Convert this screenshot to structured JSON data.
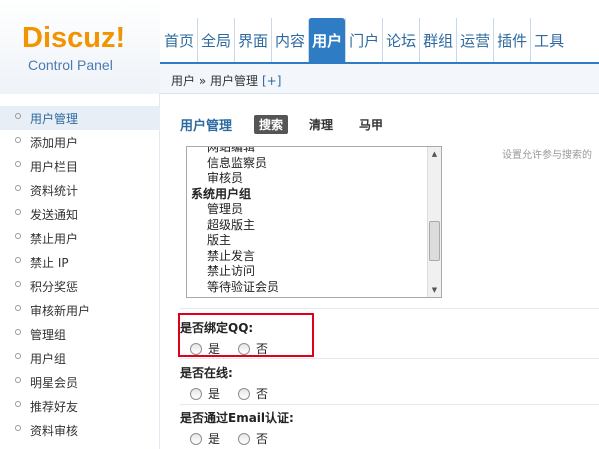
{
  "logo": {
    "title": "Discuz!",
    "subtitle": "Control Panel"
  },
  "nav": {
    "items": [
      "首页",
      "全局",
      "界面",
      "内容",
      "用户",
      "门户",
      "论坛",
      "群组",
      "运营",
      "插件",
      "工具"
    ],
    "active_index": 4
  },
  "breadcrumb": {
    "text": "用户 » 用户管理",
    "plus": "[+]"
  },
  "sidebar": {
    "items": [
      "用户管理",
      "添加用户",
      "用户栏目",
      "资料统计",
      "发送通知",
      "禁止用户",
      "禁止 IP",
      "积分奖惩",
      "审核新用户",
      "管理组",
      "用户组",
      "明星会员",
      "推荐好友",
      "资料审核"
    ],
    "active_index": 0
  },
  "subtabs": {
    "title": "用户管理",
    "items": [
      "搜索",
      "清理",
      "马甲"
    ],
    "active_index": 0
  },
  "hint": "设置允许参与搜索的",
  "listbox": {
    "options": [
      {
        "text": "网站编辑",
        "group": false
      },
      {
        "text": "信息监察员",
        "group": false
      },
      {
        "text": "审核员",
        "group": false
      },
      {
        "text": "系统用户组",
        "group": true
      },
      {
        "text": "管理员",
        "group": false
      },
      {
        "text": "超级版主",
        "group": false
      },
      {
        "text": "版主",
        "group": false
      },
      {
        "text": "禁止发言",
        "group": false
      },
      {
        "text": "禁止访问",
        "group": false
      },
      {
        "text": "等待验证会员",
        "group": false
      }
    ]
  },
  "fields": [
    {
      "label": "是否绑定QQ:",
      "yes": "是",
      "no": "否"
    },
    {
      "label": "是否在线:",
      "yes": "是",
      "no": "否"
    },
    {
      "label": "是否通过Email认证:",
      "yes": "是",
      "no": "否"
    }
  ],
  "colors": {
    "accent": "#2e7cc4",
    "logo": "#f29400",
    "highlight": "#e0001b"
  },
  "icons": {
    "scroll_up": "triangle-up-icon",
    "scroll_down": "triangle-down-icon",
    "bullet": "circle-bullet-icon"
  }
}
